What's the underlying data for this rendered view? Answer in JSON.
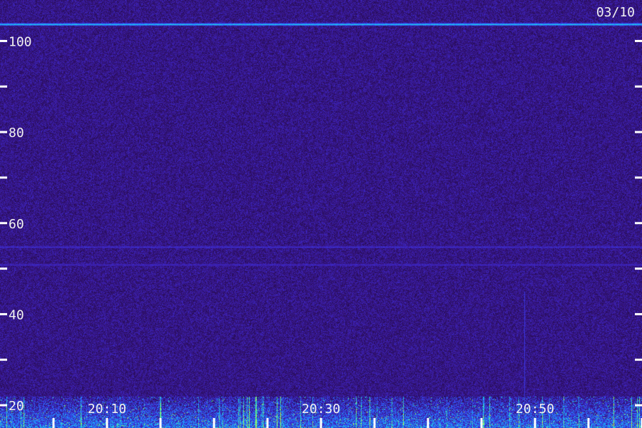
{
  "chart_data": {
    "type": "heatmap",
    "title": "",
    "date_label": "03/10",
    "xlabel": "",
    "ylabel": "",
    "x_range": [
      "20:00",
      "21:00"
    ],
    "y_range": [
      15,
      109
    ],
    "x_tick_labels": [
      "20:10",
      "20:30",
      "20:50"
    ],
    "x_minor_ticks": [
      "20:05",
      "20:10",
      "20:15",
      "20:20",
      "20:25",
      "20:30",
      "20:35",
      "20:40",
      "20:45",
      "20:50",
      "20:55",
      "21:00"
    ],
    "y_tick_labels": [
      "20",
      "40",
      "60",
      "80",
      "100"
    ],
    "y_minor_ticks": [
      20,
      30,
      40,
      50,
      60,
      70,
      80,
      90,
      100
    ],
    "colormap": [
      "#1a0640",
      "#2a0e5c",
      "#3a1890",
      "#3c2cd8",
      "#2a70ff",
      "#19c6f0",
      "#37f3a0",
      "#c8ff40"
    ],
    "background_level": 0.25,
    "features": [
      {
        "kind": "horizontal-line",
        "y": 103.7,
        "intensity": 0.75
      },
      {
        "kind": "horizontal-line",
        "y": 54.8,
        "intensity": 0.42
      },
      {
        "kind": "horizontal-line",
        "y": 50.9,
        "intensity": 0.4
      },
      {
        "kind": "low-band",
        "y_min": 15,
        "y_max": 22,
        "intensity": 0.7
      },
      {
        "kind": "vertical-line",
        "x": "20:49",
        "y_min": 22,
        "y_max": 45,
        "intensity": 0.45
      }
    ],
    "grid": false,
    "legend": "none"
  }
}
